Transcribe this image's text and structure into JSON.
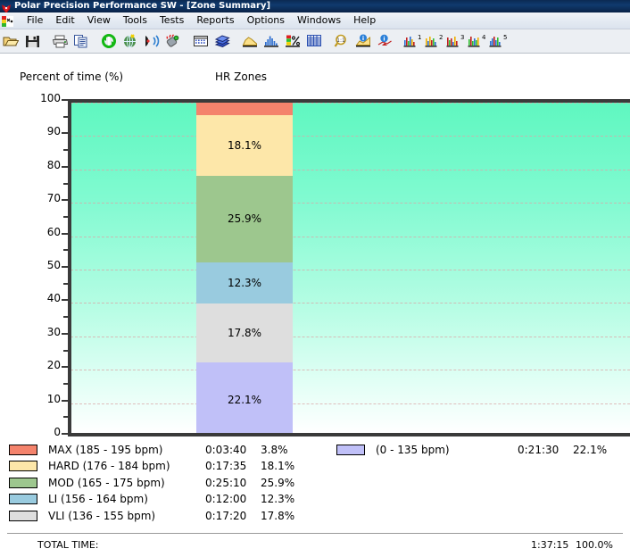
{
  "window": {
    "title": "Polar Precision Performance SW - [Zone Summary]",
    "icon": "polar-logo-icon"
  },
  "menu": {
    "app_icon": "polar-app-icon",
    "items": [
      {
        "label": "File"
      },
      {
        "label": "Edit"
      },
      {
        "label": "View"
      },
      {
        "label": "Tools"
      },
      {
        "label": "Tests"
      },
      {
        "label": "Reports"
      },
      {
        "label": "Options"
      },
      {
        "label": "Windows"
      },
      {
        "label": "Help"
      }
    ]
  },
  "toolbar": {
    "buttons": [
      {
        "name": "open-folder-icon"
      },
      {
        "name": "save-disk-icon"
      },
      {
        "name": "separator"
      },
      {
        "name": "print-icon"
      },
      {
        "name": "copy-icon"
      },
      {
        "name": "separator"
      },
      {
        "name": "refresh-sync-icon"
      },
      {
        "name": "globe-transfer-icon"
      },
      {
        "name": "infrared-receive-icon"
      },
      {
        "name": "heart-rate-sensor-icon"
      },
      {
        "name": "separator"
      },
      {
        "name": "calendar-icon"
      },
      {
        "name": "diary-book-icon"
      },
      {
        "name": "separator"
      },
      {
        "name": "area-curve-icon"
      },
      {
        "name": "bar-chart-icon"
      },
      {
        "name": "zone-percent-icon"
      },
      {
        "name": "data-table-icon"
      },
      {
        "name": "separator"
      },
      {
        "name": "zoom-magnifier-icon"
      },
      {
        "name": "info-curve-icon"
      },
      {
        "name": "info-marker-icon"
      },
      {
        "name": "separator"
      },
      {
        "name": "report-1-icon"
      },
      {
        "name": "report-2-icon"
      },
      {
        "name": "report-3-icon"
      },
      {
        "name": "report-4-icon"
      },
      {
        "name": "report-5-icon"
      }
    ]
  },
  "chart_data": {
    "type": "bar",
    "title": "HR Zones",
    "subtitle": "",
    "xlabel": "",
    "ylabel": "Percent of time (%)",
    "ylim": [
      0,
      100
    ],
    "ytick_labels": [
      "100",
      "90",
      "80",
      "70",
      "60",
      "50",
      "40",
      "30",
      "20",
      "10",
      "0"
    ],
    "ytick_values": [
      100,
      90,
      80,
      70,
      60,
      50,
      40,
      30,
      20,
      10,
      0
    ],
    "grid": true,
    "grid_style": "dashed",
    "grid_color": "#d9a8a8",
    "legend_position": "below",
    "stacked": true,
    "categories": [
      "HR Zones"
    ],
    "series": [
      {
        "name": "MAX (185 - 195 bpm)",
        "values": [
          3.8
        ],
        "time": "0:03:40",
        "percent_label": "3.8%",
        "color": "#f4836c",
        "show_label_on_bar": false
      },
      {
        "name": "HARD (176 - 184 bpm)",
        "values": [
          18.1
        ],
        "time": "0:17:35",
        "percent_label": "18.1%",
        "color": "#fde7a9",
        "show_label_on_bar": true
      },
      {
        "name": "MOD (165 - 175 bpm)",
        "values": [
          25.9
        ],
        "time": "0:25:10",
        "percent_label": "25.9%",
        "color": "#9dc78e",
        "show_label_on_bar": true
      },
      {
        "name": "LI (156 - 164 bpm)",
        "values": [
          12.3
        ],
        "time": "0:12:00",
        "percent_label": "12.3%",
        "color": "#99cbdf",
        "show_label_on_bar": true
      },
      {
        "name": "VLI (136 - 155 bpm)",
        "values": [
          17.8
        ],
        "time": "0:17:20",
        "percent_label": "17.8%",
        "color": "#dedede",
        "show_label_on_bar": true
      },
      {
        "name": "(0 - 135 bpm)",
        "values": [
          22.1
        ],
        "time": "0:21:30",
        "percent_label": "22.1%",
        "color": "#c0c0f8",
        "show_label_on_bar": true
      }
    ],
    "plot_background": "teal-to-white-vertical-gradient"
  },
  "legend": {
    "left_column": [
      {
        "swatch": "#f4836c",
        "label": "MAX (185 - 195 bpm)",
        "time": "0:03:40",
        "percent": "3.8%"
      },
      {
        "swatch": "#fde7a9",
        "label": "HARD (176 - 184 bpm)",
        "time": "0:17:35",
        "percent": "18.1%"
      },
      {
        "swatch": "#9dc78e",
        "label": "MOD (165 - 175 bpm)",
        "time": "0:25:10",
        "percent": "25.9%"
      },
      {
        "swatch": "#99cbdf",
        "label": "LI (156 - 164 bpm)",
        "time": "0:12:00",
        "percent": "12.3%"
      },
      {
        "swatch": "#dedede",
        "label": "VLI (136 - 155 bpm)",
        "time": "0:17:20",
        "percent": "17.8%"
      }
    ],
    "right_column": [
      {
        "swatch": "#c0c0f8",
        "label": "(0 - 135 bpm)",
        "time": "0:21:30",
        "percent": "22.1%"
      }
    ]
  },
  "total": {
    "label": "TOTAL TIME:",
    "time": "1:37:15",
    "percent": "100.0%"
  },
  "colors": {
    "titlebar": "#0b2a52",
    "menubar": "#e4eaf2",
    "toolbar": "#eceff3",
    "axis": "#3a3a3a",
    "gridline": "#d9a8a8"
  }
}
